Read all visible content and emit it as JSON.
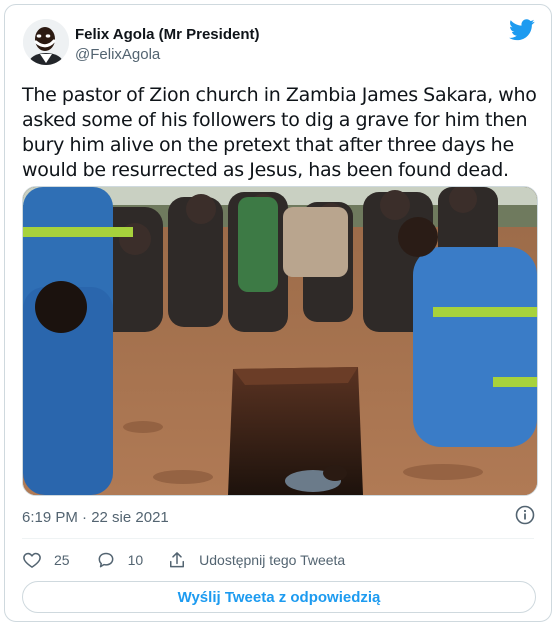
{
  "tweet": {
    "author": {
      "name": "Felix Agola (Mr President)",
      "handle": "@FelixAgola"
    },
    "text": "The pastor of Zion church in Zambia James Sakara, who asked some of his followers to dig a grave for him then bury him alive on the pretext that after three days he would be resurrected as Jesus, has been found dead.",
    "timestamp": "6:19 PM · 22 sie 2021",
    "stats": {
      "likes": "25",
      "replies": "10",
      "share_label": "Udostępnij tego Tweeta"
    },
    "reply_button_label": "Wyślij Tweeta z odpowiedzią"
  },
  "icons": {
    "brand": "twitter-bird-icon",
    "like": "heart-outline-icon",
    "reply": "speech-bubble-icon",
    "share": "share-upload-icon",
    "info": "info-circle-icon"
  },
  "colors": {
    "brand_blue": "#1d9bf0",
    "text_primary": "#0f1419",
    "text_secondary": "#536471",
    "border": "#cfd9de"
  }
}
